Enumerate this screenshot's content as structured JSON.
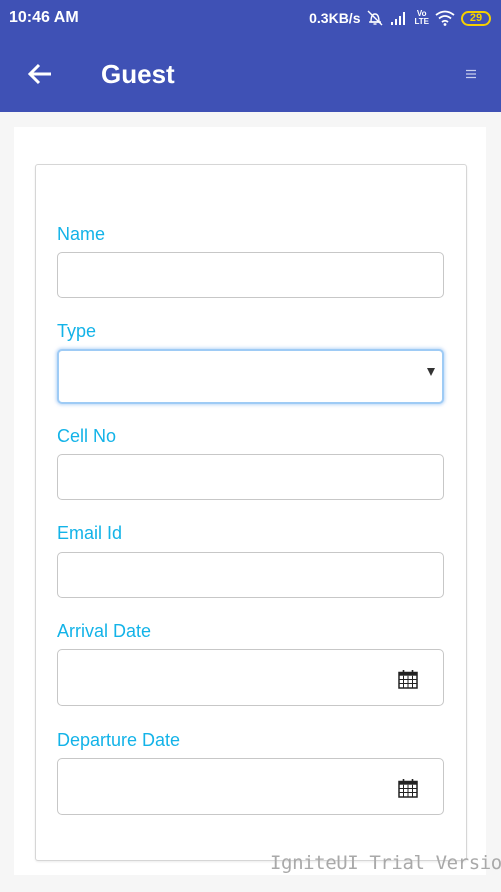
{
  "status_bar": {
    "time": "10:46 AM",
    "net_speed": "0.3KB/s",
    "volte_top": "Vo",
    "volte_bottom": "LTE",
    "battery": "29",
    "icons": [
      "alarm-off-icon",
      "signal-icon",
      "volte-icon",
      "wifi-icon",
      "battery-icon"
    ]
  },
  "app_bar": {
    "title": "Guest",
    "back_icon": "arrow-left-icon",
    "menu_icon": "menu-icon"
  },
  "form": {
    "fields": [
      {
        "label": "Name",
        "value": "",
        "kind": "text"
      },
      {
        "label": "Type",
        "value": "",
        "kind": "select"
      },
      {
        "label": "Cell No",
        "value": "",
        "kind": "text"
      },
      {
        "label": "Email Id",
        "value": "",
        "kind": "text"
      },
      {
        "label": "Arrival Date",
        "value": "",
        "kind": "date"
      },
      {
        "label": "Departure Date",
        "value": "",
        "kind": "date"
      }
    ]
  },
  "watermark": "IgniteUI Trial Version",
  "colors": {
    "app_bar": "#3f51b5",
    "label": "#13b3e8",
    "battery": "#f5d000",
    "focus_ring": "#9ecbf5"
  }
}
